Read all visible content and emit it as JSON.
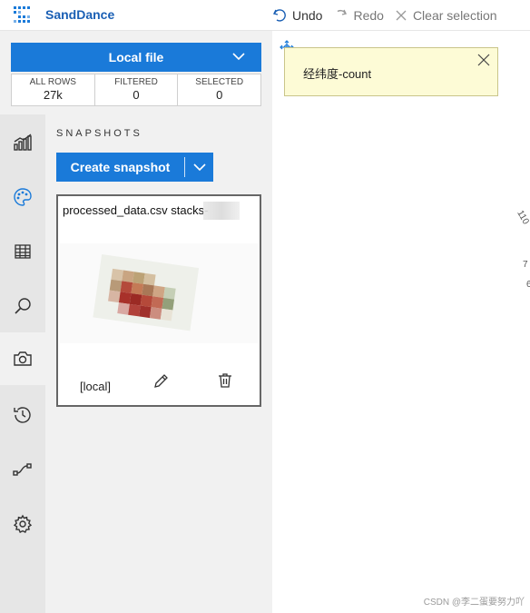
{
  "app": {
    "title": "SandDance"
  },
  "toolbar": {
    "undo": "Undo",
    "redo": "Redo",
    "clear": "Clear selection"
  },
  "data_source": {
    "label": "Local file"
  },
  "stats": [
    {
      "label": "ALL ROWS",
      "value": "27k"
    },
    {
      "label": "FILTERED",
      "value": "0"
    },
    {
      "label": "SELECTED",
      "value": "0"
    }
  ],
  "sidebar": {
    "icons": [
      "chart-icon",
      "palette-icon",
      "table-icon",
      "search-icon",
      "camera-icon",
      "history-icon",
      "transition-icon",
      "gear-icon"
    ],
    "active": "camera-icon"
  },
  "snapshots": {
    "heading": "SNAPSHOTS",
    "create_label": "Create snapshot",
    "card": {
      "title": "processed_data.csv stacks-",
      "source_tag": "[local]"
    }
  },
  "tooltip": {
    "text": "经纬度-count"
  },
  "axis_fragments": [
    "110",
    "7",
    "6"
  ],
  "watermark": "CSDN @李二蛋要努力吖",
  "colors": {
    "accent": "#1a7ad9",
    "brand_text": "#1a5fb4",
    "tooltip_bg": "#fdfbd6"
  }
}
